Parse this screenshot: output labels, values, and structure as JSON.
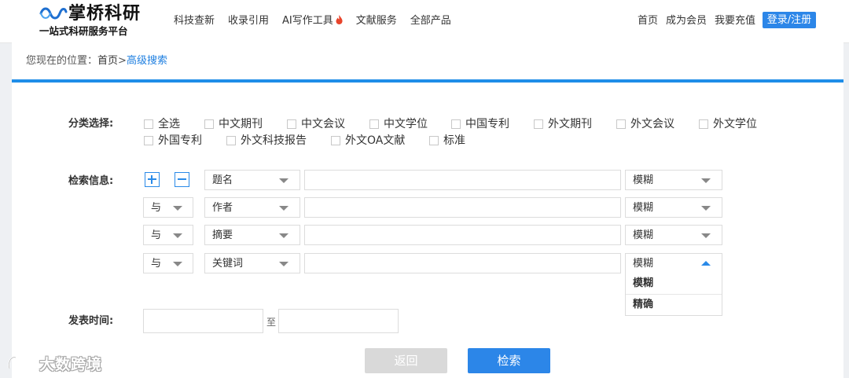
{
  "header": {
    "logo_name": "掌桥科研",
    "logo_slogan": "一站式科研服务平台",
    "nav": [
      {
        "label": "科技查新"
      },
      {
        "label": "收录引用"
      },
      {
        "label": "AI写作工具"
      },
      {
        "label": "文献服务"
      },
      {
        "label": "全部产品"
      }
    ],
    "right_links": [
      {
        "label": "首页"
      },
      {
        "label": "成为会员"
      },
      {
        "label": "我要充值"
      }
    ],
    "login_label": "登录/注册"
  },
  "breadcrumb": {
    "prefix": "您现在的位置：",
    "home": "首页",
    "separator": ">",
    "current": "高级搜索"
  },
  "form": {
    "category_label": "分类选择:",
    "categories": [
      "全选",
      "中文期刊",
      "中文会议",
      "中文学位",
      "中国专利",
      "外文期刊",
      "外文会议",
      "外文学位",
      "外国专利",
      "外文科技报告",
      "外文OA文献",
      "标准"
    ],
    "search_label": "检索信息:",
    "rows": [
      {
        "logic": "",
        "field": "题名",
        "match": "模糊"
      },
      {
        "logic": "与",
        "field": "作者",
        "match": "模糊"
      },
      {
        "logic": "与",
        "field": "摘要",
        "match": "模糊"
      },
      {
        "logic": "与",
        "field": "关键词",
        "match": "模糊"
      }
    ],
    "match_options": [
      "模糊",
      "精确"
    ],
    "date_label": "发表时间:",
    "date_to": "至",
    "back_label": "返回",
    "search_button": "检索"
  },
  "watermark": "大数跨境",
  "colors": {
    "accent": "#2c86e8",
    "breadcrumb_current": "#1f7fe0",
    "disabled_button": "#d9d9d9"
  }
}
